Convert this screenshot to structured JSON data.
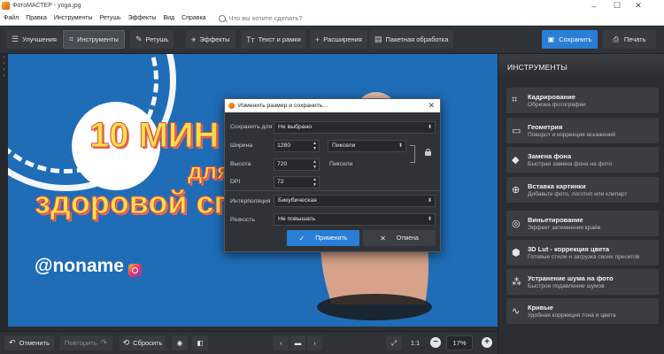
{
  "window": {
    "title": "ФотоМАСТЕР - yoga.jpg",
    "minimize": "–",
    "maximize": "☐",
    "close": "✕"
  },
  "menu": {
    "items": [
      "Файл",
      "Правка",
      "Инструменты",
      "Ретушь",
      "Эффекты",
      "Вид",
      "Справка"
    ],
    "search_placeholder": "Что вы хотите сделать?"
  },
  "toolbar": {
    "tabs": [
      {
        "label": "Улучшения",
        "icon": "sliders-icon"
      },
      {
        "label": "Инструменты",
        "icon": "crop-icon"
      },
      {
        "label": "Ретушь",
        "icon": "brush-icon"
      },
      {
        "label": "Эффекты",
        "icon": "magic-wand-icon"
      },
      {
        "label": "Текст и рамки",
        "icon": "text-icon"
      },
      {
        "label": "Расширения",
        "icon": "plus-icon"
      },
      {
        "label": "Пакетная обработка",
        "icon": "batch-icon"
      }
    ],
    "active_tab": "Инструменты",
    "save_label": "Сохранить",
    "print_label": "Печать"
  },
  "photo": {
    "title_line1": "10 МИН",
    "title_line2": "для",
    "title_line3": "здоровой сп",
    "handle": "@noname"
  },
  "bottombar": {
    "undo_label": "Отменить",
    "redo_label": "Повторить",
    "reset_label": "Сбросить",
    "ratio_label": "1:1",
    "zoom_value": "17%"
  },
  "right_panel": {
    "header": "ИНСТРУМЕНТЫ",
    "items": [
      {
        "title": "Кадрирование",
        "subtitle": "Обрезка фотографии",
        "icon": "crop-icon"
      },
      {
        "title": "Геометрия",
        "subtitle": "Поворот и коррекция искажений",
        "icon": "geometry-icon"
      },
      {
        "title": "Замена фона",
        "subtitle": "Быстрая замена фона на фото",
        "icon": "bucket-icon"
      },
      {
        "title": "Вставка картинки",
        "subtitle": "Добавьте фото, логотип или клипарт",
        "icon": "image-insert-icon"
      },
      {
        "title": "Виньетирование",
        "subtitle": "Эффект затемнения краёв",
        "icon": "vignette-icon"
      },
      {
        "title": "3D Lut - коррекция цвета",
        "subtitle": "Готовые стили и загрузка своих пресетов",
        "icon": "cube-icon"
      },
      {
        "title": "Устранение шума на фото",
        "subtitle": "Быстрое подавление шумов",
        "icon": "denoise-icon"
      },
      {
        "title": "Кривые",
        "subtitle": "Удобная коррекция тона и цвета",
        "icon": "curves-icon"
      }
    ]
  },
  "dialog": {
    "title": "Изменить размер и сохранить...",
    "save_for_label": "Сохранить для",
    "save_for_value": "Не выбрано",
    "width_label": "Ширина",
    "width_value": "1280",
    "height_label": "Высота",
    "height_value": "720",
    "dpi_label": "DPI",
    "dpi_value": "72",
    "unit_select": "Пиксели",
    "unit_static": "Пиксели",
    "interpolation_label": "Интерполяция",
    "interpolation_value": "Бикубическая",
    "sharpness_label": "Резкость",
    "sharpness_value": "Не повышать",
    "apply_label": "Применить",
    "cancel_label": "Отмена"
  },
  "colors": {
    "accent": "#2a7ed6",
    "photo_background": "#1f6db7",
    "title_fill": "#f7e14a",
    "title_outline": "#e24a4a"
  }
}
